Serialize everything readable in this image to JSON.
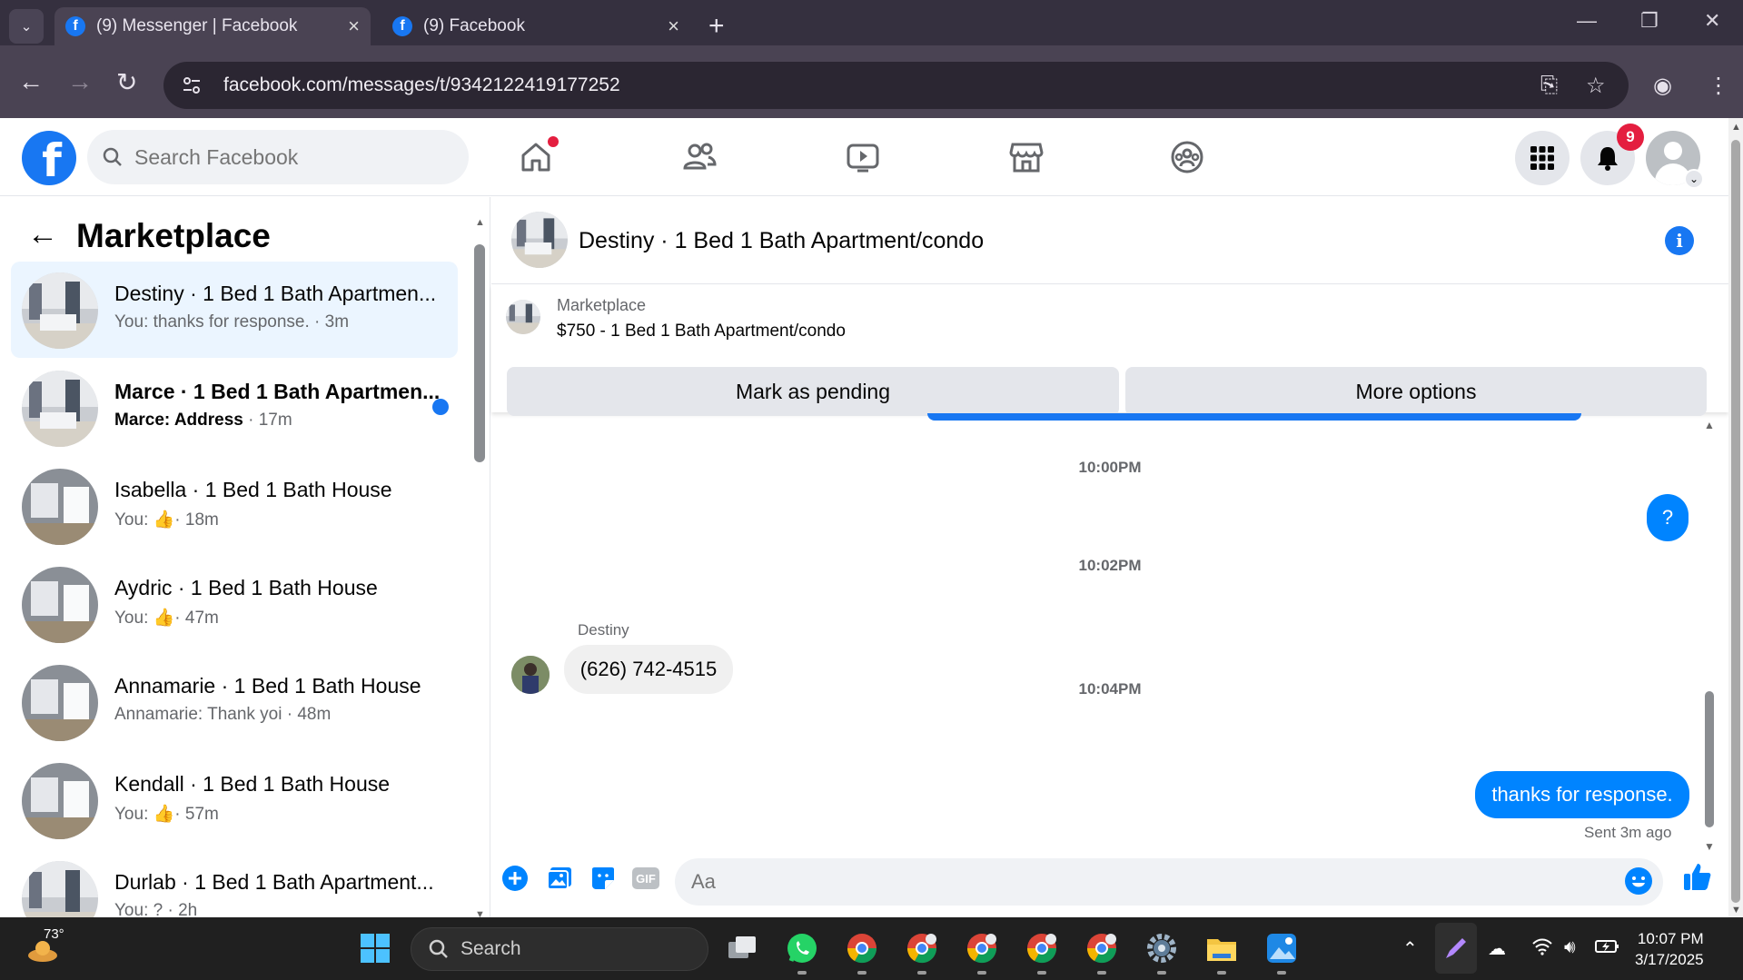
{
  "browser": {
    "tabs": [
      {
        "title": "(9) Messenger | Facebook",
        "active": true
      },
      {
        "title": "(9) Facebook",
        "active": false
      }
    ],
    "url": "facebook.com/messages/t/9342122419177252"
  },
  "fb_header": {
    "search_placeholder": "Search Facebook",
    "notification_count": "9",
    "logo_letter": "f"
  },
  "left_panel": {
    "title": "Marketplace",
    "conversations": [
      {
        "name": "Destiny · 1 Bed 1 Bath Apartmen...",
        "snippet": "You: thanks for response. · 3m",
        "selected": true,
        "unread": false
      },
      {
        "name": "Marce · 1 Bed 1 Bath Apartmen...",
        "snippet_sender": "Marce: Address",
        "snippet_time": " · 17m",
        "unread": true
      },
      {
        "name": "Isabella · 1 Bed 1 Bath House",
        "snippet_prefix": "You:",
        "snippet_time": "· 18m"
      },
      {
        "name": "Aydric · 1 Bed 1 Bath House",
        "snippet_prefix": "You:",
        "snippet_time": "· 47m"
      },
      {
        "name": "Annamarie · 1 Bed 1 Bath House",
        "snippet": "Annamarie: Thank yoi · 48m"
      },
      {
        "name": "Kendall · 1 Bed 1 Bath House",
        "snippet_prefix": "You:",
        "snippet_time": "· 57m"
      },
      {
        "name": "Durlab · 1 Bed 1 Bath Apartment...",
        "snippet": "You: ? · 2h"
      }
    ]
  },
  "chat": {
    "title": "Destiny · 1 Bed 1 Bath Apartment/condo",
    "marketplace_label": "Marketplace",
    "listing": "$750 - 1 Bed 1 Bath Apartment/condo",
    "mark_pending_label": "Mark as pending",
    "more_options_label": "More options",
    "messages": [
      {
        "timestamp": "10:00PM"
      },
      {
        "direction": "out",
        "text": "?"
      },
      {
        "timestamp": "10:02PM"
      },
      {
        "direction": "in",
        "sender": "Destiny",
        "text": "(626) 742-4515"
      },
      {
        "timestamp": "10:04PM"
      },
      {
        "direction": "out",
        "text": "thanks for response.",
        "status": "Sent 3m ago"
      }
    ],
    "composer_placeholder": "Aa",
    "gif_label": "GIF"
  },
  "taskbar": {
    "weather_temp": "73°",
    "search_label": "Search",
    "time": "10:07 PM",
    "date": "3/17/2025"
  },
  "colors": {
    "fb_blue": "#1877f2",
    "messenger_blue": "#0084ff",
    "selected_row": "#ebf5ff",
    "notification_red": "#e41e3f"
  }
}
